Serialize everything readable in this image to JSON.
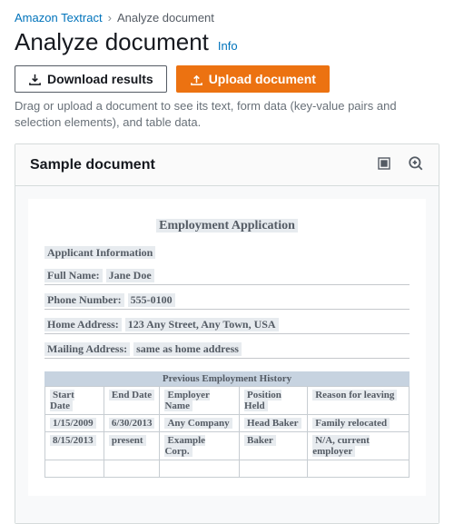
{
  "breadcrumb": {
    "root": "Amazon Textract",
    "current": "Analyze document"
  },
  "heading": "Analyze document",
  "infoLabel": "Info",
  "buttons": {
    "download": "Download results",
    "upload": "Upload document"
  },
  "helper": "Drag or upload a document to see its text, form data (key-value pairs and selection elements), and table data.",
  "panel": {
    "title": "Sample document"
  },
  "doc": {
    "title": "Employment Application",
    "sections": {
      "applicant": "Applicant Information"
    },
    "fields": {
      "fullName": {
        "label": "Full Name:",
        "value": "Jane Doe"
      },
      "phone": {
        "label": "Phone Number:",
        "value": "555-0100"
      },
      "homeAddr": {
        "label": "Home Address:",
        "value": "123 Any Street, Any Town, USA"
      },
      "mailAddr": {
        "label": "Mailing Address:",
        "value": "same as home address"
      }
    },
    "historyTitle": "Previous Employment History",
    "historyHeaders": {
      "start": "Start Date",
      "end": "End Date",
      "emp": "Employer Name",
      "pos": "Position Held",
      "reason": "Reason for leaving"
    },
    "history": [
      {
        "start": "1/15/2009",
        "end": "6/30/2013",
        "emp": "Any Company",
        "pos": "Head Baker",
        "reason": "Family relocated"
      },
      {
        "start": "8/15/2013",
        "end": "present",
        "emp": "Example Corp.",
        "pos": "Baker",
        "reason": "N/A, current employer"
      }
    ]
  }
}
